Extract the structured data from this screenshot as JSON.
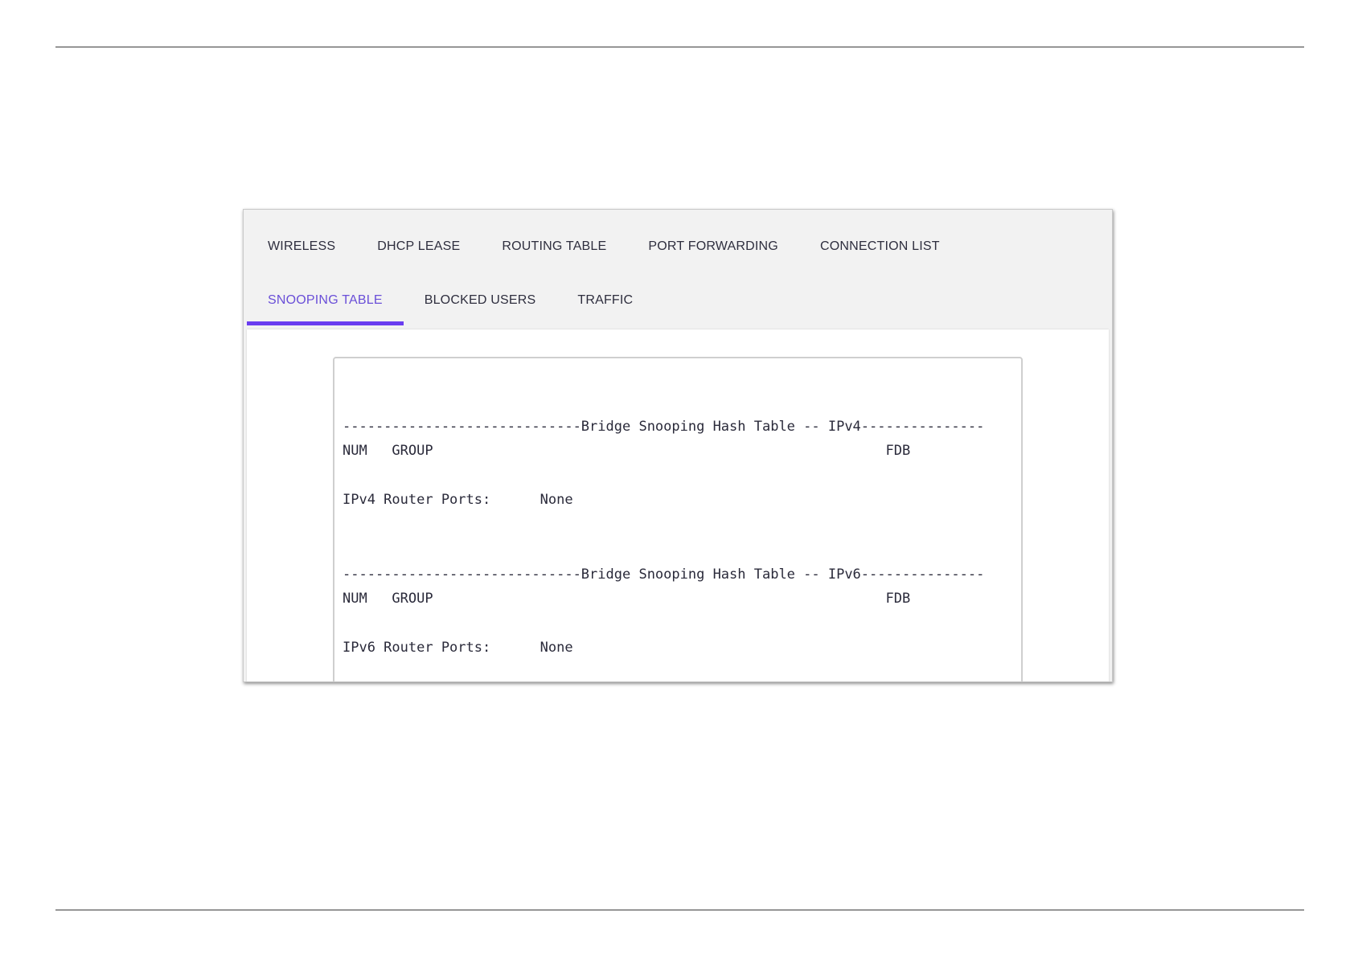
{
  "tabs": {
    "row1": [
      {
        "label": "WIRELESS"
      },
      {
        "label": "DHCP LEASE"
      },
      {
        "label": "ROUTING TABLE"
      },
      {
        "label": "PORT FORWARDING"
      },
      {
        "label": "CONNECTION LIST"
      }
    ],
    "row2": [
      {
        "label": "SNOOPING TABLE",
        "active": true
      },
      {
        "label": "BLOCKED USERS"
      },
      {
        "label": "TRAFFIC"
      }
    ]
  },
  "terminal": {
    "ipv4": {
      "header": "-----------------------------Bridge Snooping Hash Table -- IPv4---------------",
      "columns": "NUM   GROUP                                                       FDB",
      "router_ports": "IPv4 Router Ports:      None"
    },
    "ipv6": {
      "header": "-----------------------------Bridge Snooping Hash Table -- IPv6---------------",
      "columns": "NUM   GROUP                                                       FDB",
      "router_ports": "IPv6 Router Ports:      None"
    }
  },
  "colors": {
    "accent": "#6a3df0",
    "active_tab_text": "#6a4fd8",
    "tab_bar_bg": "#f2f2f2"
  }
}
